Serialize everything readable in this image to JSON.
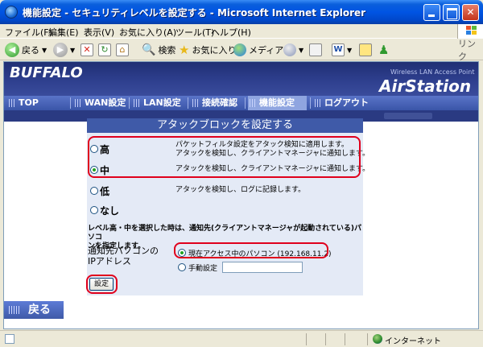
{
  "window": {
    "title": "機能設定 - セキュリティレベルを設定する - Microsoft Internet Explorer"
  },
  "menu": [
    "ファイル(F)",
    "編集(E)",
    "表示(V)",
    "お気に入り(A)",
    "ツール(T)",
    "ヘルプ(H)"
  ],
  "toolbar": {
    "back_label": "戻る",
    "search_label": "検索",
    "favorites_label": "お気に入り",
    "media_label": "メディア",
    "links_label": "リンク"
  },
  "router": {
    "brand": "BUFFALO",
    "product_sub": "Wireless LAN Access Point",
    "product": "AirStation",
    "nav": [
      "TOP",
      "WAN設定",
      "LAN設定",
      "接続確認",
      "機能設定",
      "ログアウト"
    ],
    "active_nav": "機能設定"
  },
  "panel": {
    "title": "アタックブロックを設定する",
    "options": [
      {
        "label": "高",
        "selected": false,
        "desc": [
          "パケットフィルタ設定をアタック検知に適用します。",
          "アタックを検知し、クライアントマネージャに通知します。"
        ]
      },
      {
        "label": "中",
        "selected": true,
        "desc": [
          "アタックを検知し、クライアントマネージャに通知します。"
        ]
      },
      {
        "label": "低",
        "selected": false,
        "desc": [
          "アタックを検知し、ログに記録します。"
        ]
      },
      {
        "label": "なし",
        "selected": false,
        "desc": []
      }
    ],
    "notice_line1": "レベル高・中を選択した時は、通知先(クライアントマネージャが起動されている)パソコ",
    "notice_line2": "ンを指定します。",
    "field_label_line1": "通知先パソコンの",
    "field_label_line2": "IPアドレス",
    "addr_current": "現在アクセス中のパソコン (192.168.11.2)",
    "addr_manual": "手動設定",
    "set_button": "設定",
    "back_button": "戻る"
  },
  "status": {
    "zone": "インターネット"
  }
}
